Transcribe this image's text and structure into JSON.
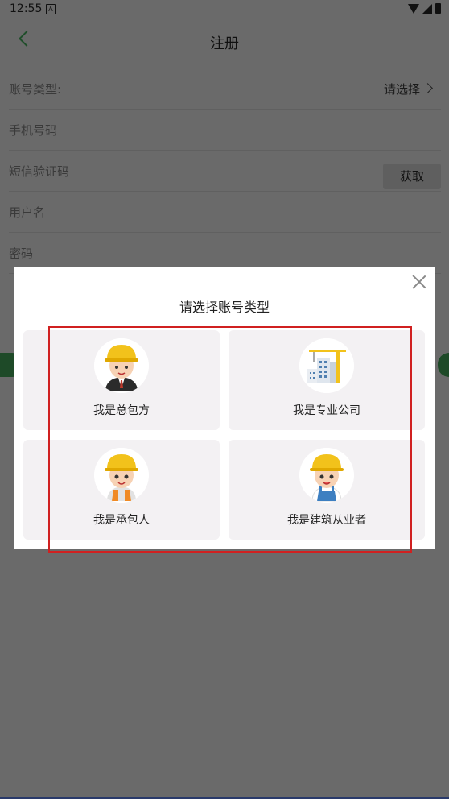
{
  "status_bar": {
    "time": "12:55",
    "notification_icon": "A"
  },
  "app_bar": {
    "title": "注册"
  },
  "form": {
    "account_type": {
      "label": "账号类型:",
      "value": "请选择"
    },
    "phone": {
      "placeholder": "手机号码"
    },
    "sms_code": {
      "placeholder": "短信验证码",
      "button": "获取"
    },
    "username": {
      "placeholder": "用户名"
    },
    "password": {
      "placeholder": "密码"
    }
  },
  "dialog": {
    "title": "请选择账号类型",
    "options": [
      {
        "label": "我是总包方",
        "icon": "worker-suit-icon"
      },
      {
        "label": "我是专业公司",
        "icon": "crane-building-icon"
      },
      {
        "label": "我是承包人",
        "icon": "worker-vest-icon"
      },
      {
        "label": "我是建筑从业者",
        "icon": "worker-overalls-icon"
      }
    ]
  },
  "colors": {
    "overlay": "#6a6a6a",
    "accent_green": "#1e4a28",
    "highlight": "#d02020",
    "card_bg": "#f3f1f3",
    "helmet": "#f2c21b"
  }
}
